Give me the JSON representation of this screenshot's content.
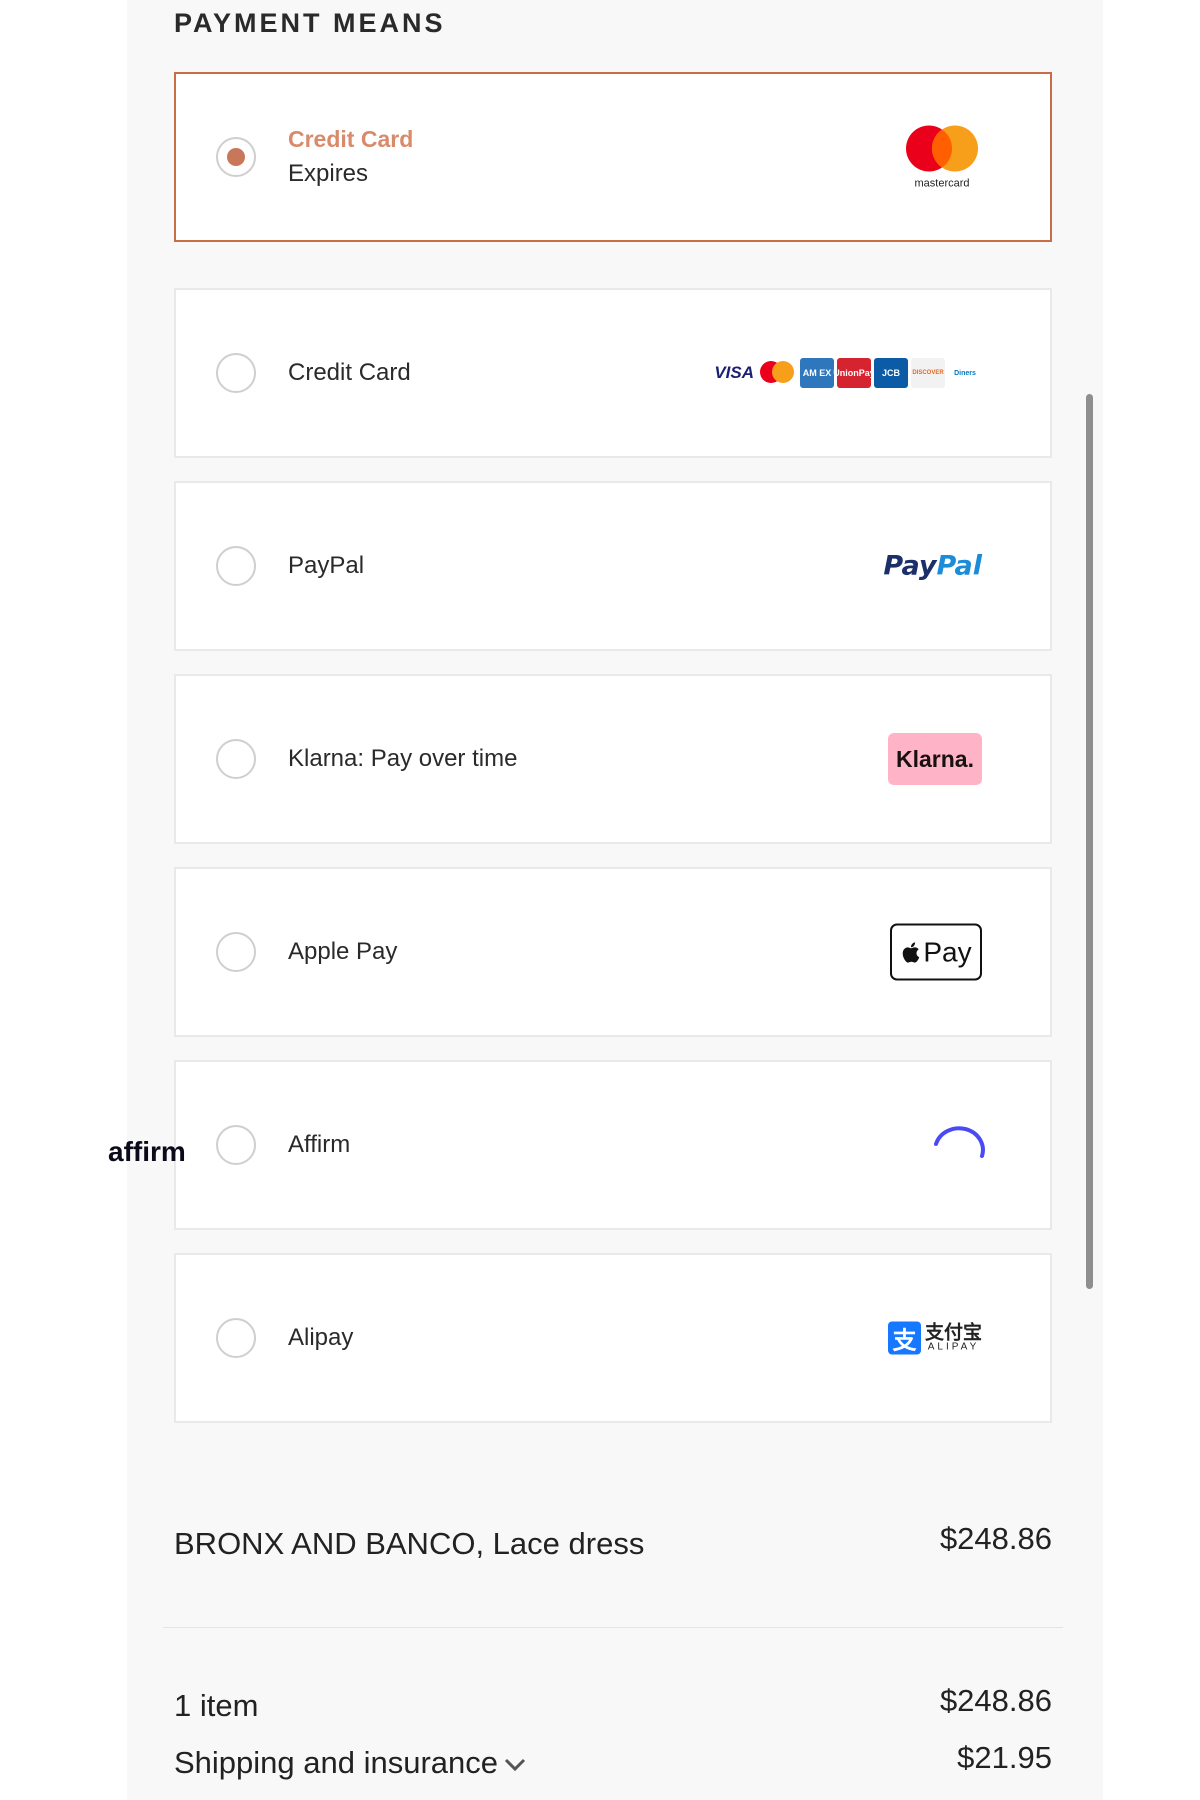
{
  "section_title": "PAYMENT MEANS",
  "payment_methods": [
    {
      "label": "Credit Card",
      "sub": "Expires",
      "selected": true,
      "logo": "mastercard-logo",
      "logo_text": "mastercard"
    },
    {
      "label": "Credit Card",
      "selected": false,
      "logo": "card-brands-logos",
      "brands": [
        "VISA",
        "AM EX",
        "UnionPay",
        "JCB",
        "DISCOVER",
        "Diners"
      ]
    },
    {
      "label": "PayPal",
      "selected": false,
      "logo": "paypal-logo",
      "logo_text_a": "Pay",
      "logo_text_b": "Pal"
    },
    {
      "label": "Klarna: Pay over time",
      "selected": false,
      "logo": "klarna-logo",
      "logo_text": "Klarna."
    },
    {
      "label": "Apple Pay",
      "selected": false,
      "logo": "apple-pay-logo",
      "logo_text": "Pay"
    },
    {
      "label": "Affirm",
      "selected": false,
      "logo": "affirm-logo",
      "logo_text": "affirm"
    },
    {
      "label": "Alipay",
      "selected": false,
      "logo": "alipay-logo",
      "logo_text_cn": "支付宝",
      "logo_text_en": "ALIPAY",
      "logo_mark": "支"
    }
  ],
  "order": {
    "product_name": "BRONX AND BANCO, Lace dress",
    "product_price": "$248.86",
    "items_label": "1 item",
    "items_price": "$248.86",
    "shipping_label": "Shipping and insurance",
    "shipping_price": "$21.95"
  },
  "colors": {
    "accent": "#c86d47",
    "selected_label": "#d98a6a"
  }
}
